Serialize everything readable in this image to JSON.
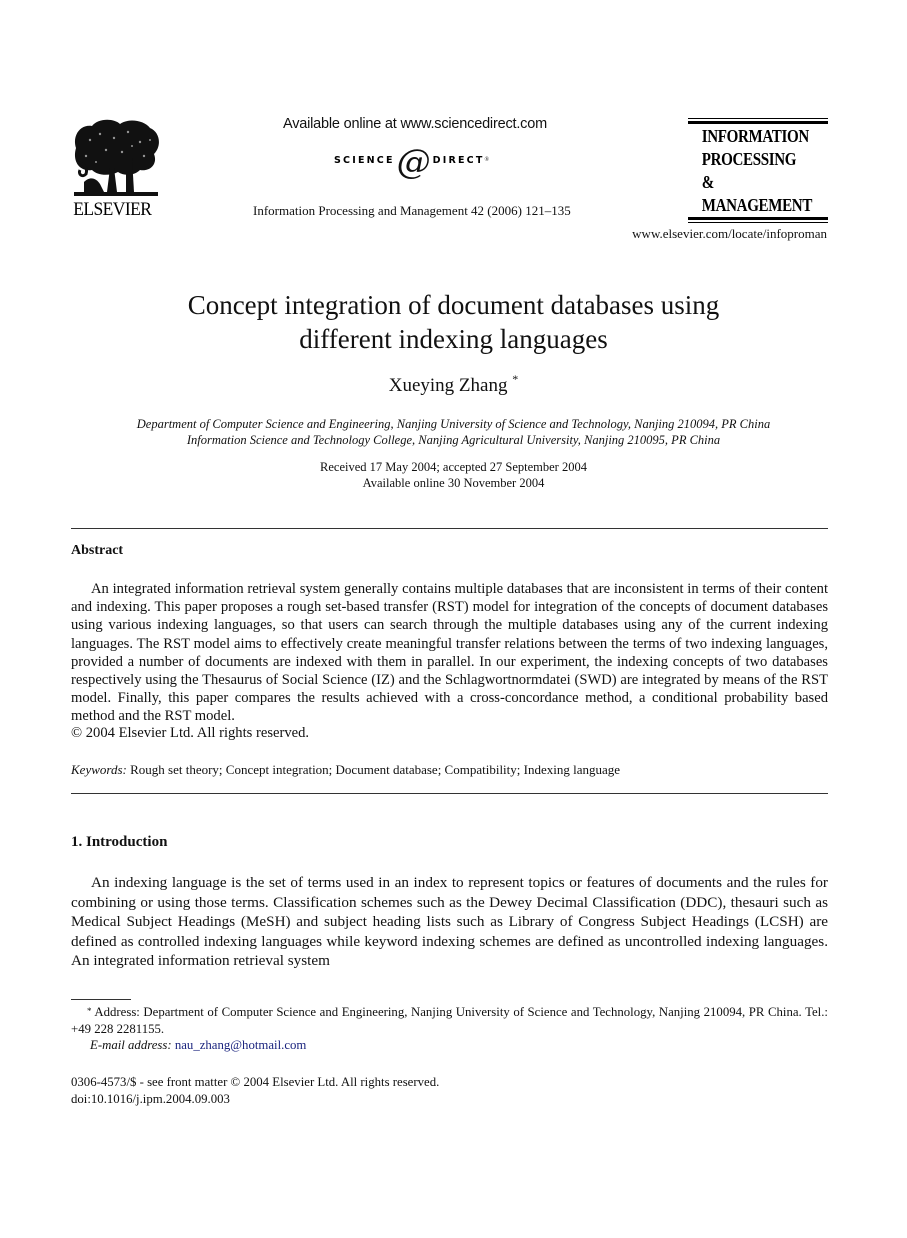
{
  "header": {
    "publisher_logo_text": "ELSEVIER",
    "available_online": "Available online at www.sciencedirect.com",
    "sciencedirect_logo": {
      "left": "SCIENCE",
      "mark": "d",
      "right": "DIRECT",
      "registered": "®"
    },
    "journal_citation": "Information Processing and Management 42 (2006) 121–135",
    "journal_logo_lines": [
      "INFORMATION",
      "PROCESSING",
      "&",
      "MANAGEMENT"
    ],
    "journal_url": "www.elsevier.com/locate/infoproman"
  },
  "title": {
    "line1": "Concept integration of document databases using",
    "line2": "different indexing languages"
  },
  "author": {
    "name": "Xueying Zhang",
    "marker": "*"
  },
  "affiliations": [
    "Department of Computer Science and Engineering, Nanjing University of Science and Technology, Nanjing 210094, PR China",
    "Information Science and Technology College, Nanjing Agricultural University, Nanjing 210095, PR China"
  ],
  "dates": {
    "received": "Received 17 May 2004; accepted 27 September 2004",
    "online": "Available online 30 November 2004"
  },
  "abstract": {
    "heading": "Abstract",
    "text": "An integrated information retrieval system generally contains multiple databases that are inconsistent in terms of their content and indexing. This paper proposes a rough set-based transfer (RST) model for integration of the concepts of document databases using various indexing languages, so that users can search through the multiple databases using any of the current indexing languages. The RST model aims to effectively create meaningful transfer relations between the terms of two indexing languages, provided a number of documents are indexed with them in parallel. In our experiment, the indexing concepts of two databases respectively using the Thesaurus of Social Science (IZ) and the Schlagwortnormdatei (SWD) are integrated by means of the RST model. Finally, this paper compares the results achieved with a cross-concordance method, a conditional probability based method and the RST model.",
    "copyright": "© 2004 Elsevier Ltd. All rights reserved."
  },
  "keywords": {
    "label": "Keywords:",
    "text": "Rough set theory; Concept integration; Document database; Compatibility; Indexing language"
  },
  "introduction": {
    "heading": "1. Introduction",
    "text": "An indexing language is the set of terms used in an index to represent topics or features of documents and the rules for combining or using those terms. Classification schemes such as the Dewey Decimal Classification (DDC), thesauri such as Medical Subject Headings (MeSH) and subject heading lists such as Library of Congress Subject Headings (LCSH) are defined as controlled indexing languages while keyword indexing schemes are defined as uncontrolled indexing languages. An integrated information retrieval system"
  },
  "footnote": {
    "marker": "*",
    "address": "Address: Department of Computer Science and Engineering, Nanjing University of Science and Technology, Nanjing 210094, PR China. Tel.: +49 228 2281155.",
    "email_label": "E-mail address:",
    "email": "nau_zhang@hotmail.com",
    "email_color": "#1a237e"
  },
  "front_matter": {
    "issn": "0306-4573/$ - see front matter  © 2004 Elsevier Ltd. All rights reserved.",
    "doi": "doi:10.1016/j.ipm.2004.09.003"
  }
}
